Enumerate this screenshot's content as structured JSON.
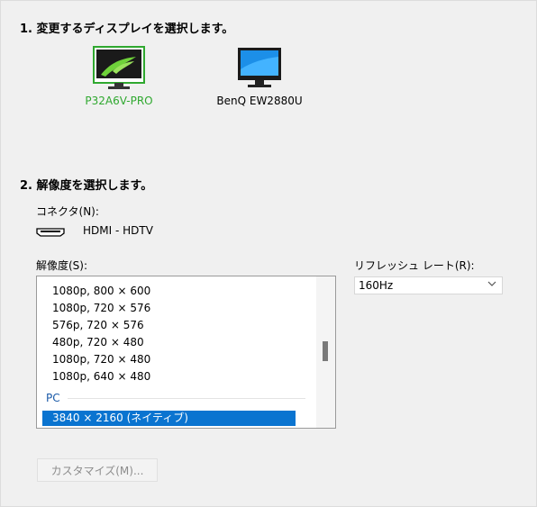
{
  "step1": {
    "heading": "1. 変更するディスプレイを選択します。"
  },
  "displays": [
    {
      "label": "P32A6V-PRO",
      "selected": true,
      "accent": "#2fa82f"
    },
    {
      "label": "BenQ EW2880U",
      "selected": false
    }
  ],
  "step2": {
    "heading": "2. 解像度を選択します。"
  },
  "connector": {
    "label": "コネクタ(N):",
    "value": "HDMI - HDTV",
    "icon": "hdmi-icon"
  },
  "resolution": {
    "label": "解像度(S):",
    "items": [
      "1080p, 800 × 600",
      "1080p, 720 × 576",
      "576p, 720 × 576",
      "480p, 720 × 480",
      "1080p, 720 × 480",
      "1080p, 640 × 480"
    ],
    "group": "PC",
    "selected": "3840 × 2160 (ネイティブ)"
  },
  "refresh": {
    "label": "リフレッシュ レート(R):",
    "value": "160Hz"
  },
  "customize": {
    "label": "カスタマイズ(M)..."
  },
  "colors": {
    "selection": "#0a74d0",
    "group": "#1a5aa8"
  }
}
